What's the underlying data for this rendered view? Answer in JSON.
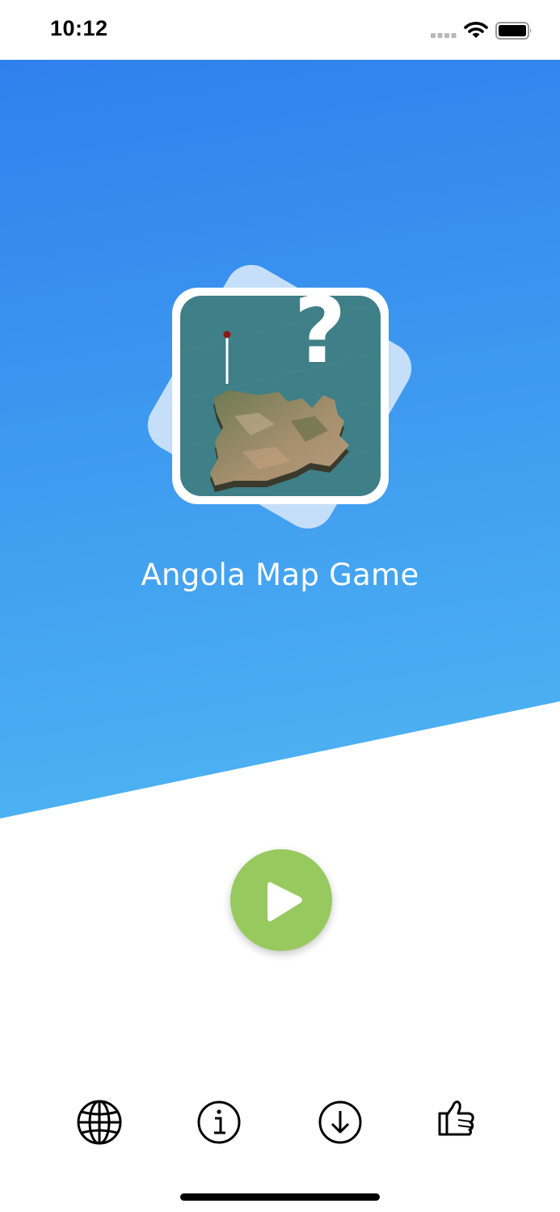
{
  "status_bar": {
    "time": "10:12"
  },
  "app": {
    "title": "Angola Map Game",
    "icon_glyph": "?"
  },
  "icons": {
    "app_icon": "angola-map-question-icon",
    "play": "play-icon",
    "language": "globe-icon",
    "info": "info-icon",
    "download": "download-icon",
    "rate": "thumbs-up-icon"
  },
  "colors": {
    "gradient_top": "#2f80ed",
    "gradient_bottom": "#4aaef2",
    "icon_background_card": "#c5defa",
    "icon_tile": "#3f7f87",
    "play_button": "#97c95f",
    "map_land": "#9c8a6a",
    "pin_head": "#8b1a1a"
  }
}
